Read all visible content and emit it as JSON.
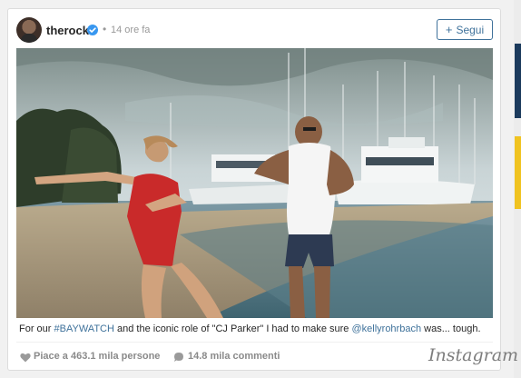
{
  "post": {
    "username": "therock",
    "dot": "•",
    "time": "14 ore fa",
    "follow_label": "Segui",
    "follow_plus": "+",
    "caption": {
      "prefix": "For our ",
      "hashtag": "#BAYWATCH",
      "middle": " and the iconic role of \"CJ Parker\" I had to make sure ",
      "mention": "@kellyrohrbach",
      "suffix": " was... tough."
    },
    "likes": "Piace a 463.1 mila persone",
    "comments": "14.8 mila commenti",
    "brand": "Instagram"
  },
  "colors": {
    "link": "#3f729b",
    "verified": "#3897f0",
    "muted": "#8a8a8a"
  },
  "icons": [
    "verified-badge-icon",
    "heart-icon",
    "comment-bubble-icon",
    "instagram-logo"
  ]
}
